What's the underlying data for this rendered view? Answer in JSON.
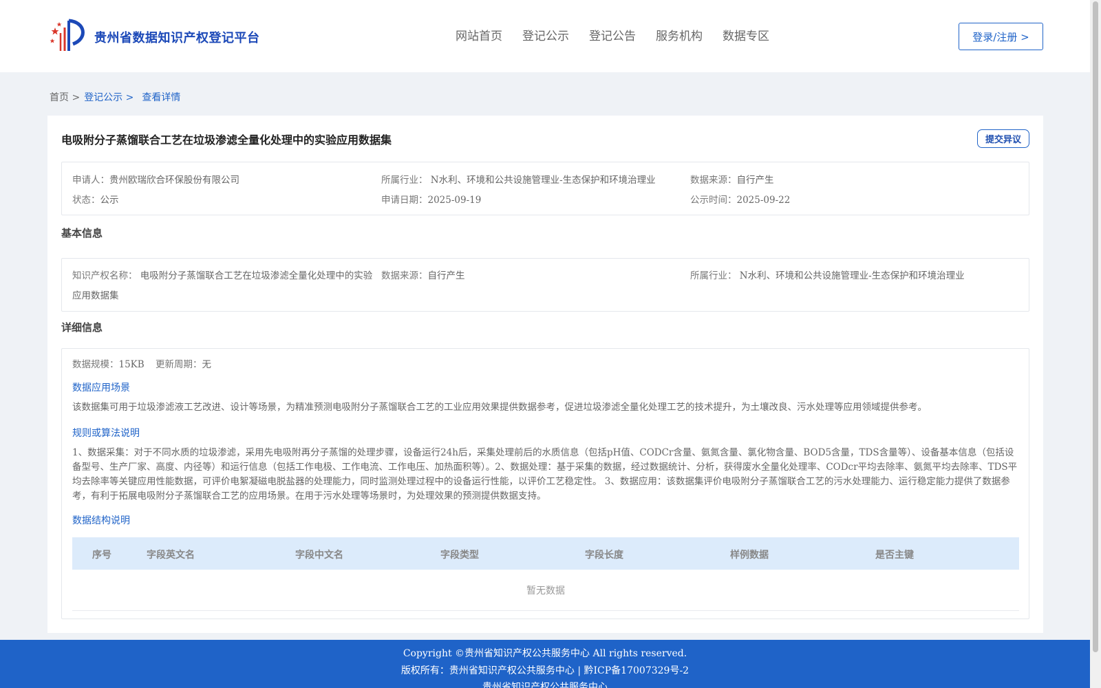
{
  "header": {
    "site_title": "贵州省数据知识产权登记平台",
    "nav": [
      "网站首页",
      "登记公示",
      "登记公告",
      "服务机构",
      "数据专区"
    ],
    "login_label": "登录/注册 >"
  },
  "breadcrumb": {
    "home": "首页 >",
    "parent": "登记公示 >",
    "current": "查看详情"
  },
  "record": {
    "title": "电吸附分子蒸馏联合工艺在垃圾渗滤全量化处理中的实验应用数据集",
    "objection_label": "提交异议",
    "summary": {
      "applicant": {
        "label": "申请人：",
        "value": "贵州欧瑞欣合环保股份有限公司"
      },
      "industry": {
        "label": "所属行业：",
        "value": "N水利、环境和公共设施管理业-生态保护和环境治理业"
      },
      "source": {
        "label": "数据来源：",
        "value": "自行产生"
      },
      "status": {
        "label": "状态：",
        "value": "公示"
      },
      "apply_date": {
        "label": "申请日期：",
        "value": "2025-09-19"
      },
      "publish_date": {
        "label": "公示时间：",
        "value": "2025-09-22"
      }
    }
  },
  "basic": {
    "heading": "基本信息",
    "ip_name_label": "知识产权名称：",
    "ip_name_line1": "电吸附分子蒸馏联合工艺在垃圾渗滤全量化处理中的实验",
    "ip_name_line2": "应用数据集",
    "source_label": "数据来源：",
    "source_value": "自行产生",
    "industry_label": "所属行业：",
    "industry_value": "N水利、环境和公共设施管理业-生态保护和环境治理业"
  },
  "detail": {
    "heading": "详细信息",
    "scale_label": "数据规模：",
    "scale_value": "15KB",
    "cycle_label": "更新周期：",
    "cycle_value": "无",
    "scenario_title": "数据应用场景",
    "scenario_text": "该数据集可用于垃圾渗滤液工艺改进、设计等场景，为精准预测电吸附分子蒸馏联合工艺的工业应用效果提供数据参考，促进垃圾渗滤全量化处理工艺的技术提升，为土壤改良、污水处理等应用领域提供参考。",
    "rules_title": "规则或算法说明",
    "rules_text": "1、数据采集：对于不同水质的垃圾渗滤，采用先电吸附再分子蒸馏的处理步骤，设备运行24h后，采集处理前后的水质信息（包括pH值、CODCr含量、氨氮含量、氯化物含量、BOD5含量，TDS含量等）、设备基本信息（包括设备型号、生产厂家、高度、内径等）和运行信息（包括工作电极、工作电流、工作电压、加热面积等）。2、数据处理：基于采集的数据，经过数据统计、分析，获得废水全量化处理率、CODcr平均去除率、氨氮平均去除率、TDS平均去除率等关键应用性能数据，可评价电絮凝磁电脱盐器的处理能力，同时监测处理过程中的设备运行性能，以评价工艺稳定性。 3、数据应用：该数据集评价电吸附分子蒸馏联合工艺的污水处理能力、运行稳定能力提供了数据参考，有利于拓展电吸附分子蒸馏联合工艺的应用场景。在用于污水处理等场景时，为处理效果的预测提供数据支持。",
    "structure_title": "数据结构说明",
    "table_headers": [
      "序号",
      "字段英文名",
      "字段中文名",
      "字段类型",
      "字段长度",
      "样例数据",
      "是否主键"
    ],
    "empty_text": "暂无数据"
  },
  "footer": {
    "line1": "Copyright ©贵州省知识产权公共服务中心 All rights reserved.",
    "line2": "版权所有：贵州省知识产权公共服务中心 | 黔ICP备17007329号-2",
    "line3": "贵州省知识产权公共服务中心"
  },
  "colors": {
    "brand_blue": "#1f63c8",
    "title_blue": "#1c49b8",
    "footer_bg": "#1f63c8",
    "page_bg": "#eff2f6",
    "table_head_bg": "#dcebfb"
  }
}
